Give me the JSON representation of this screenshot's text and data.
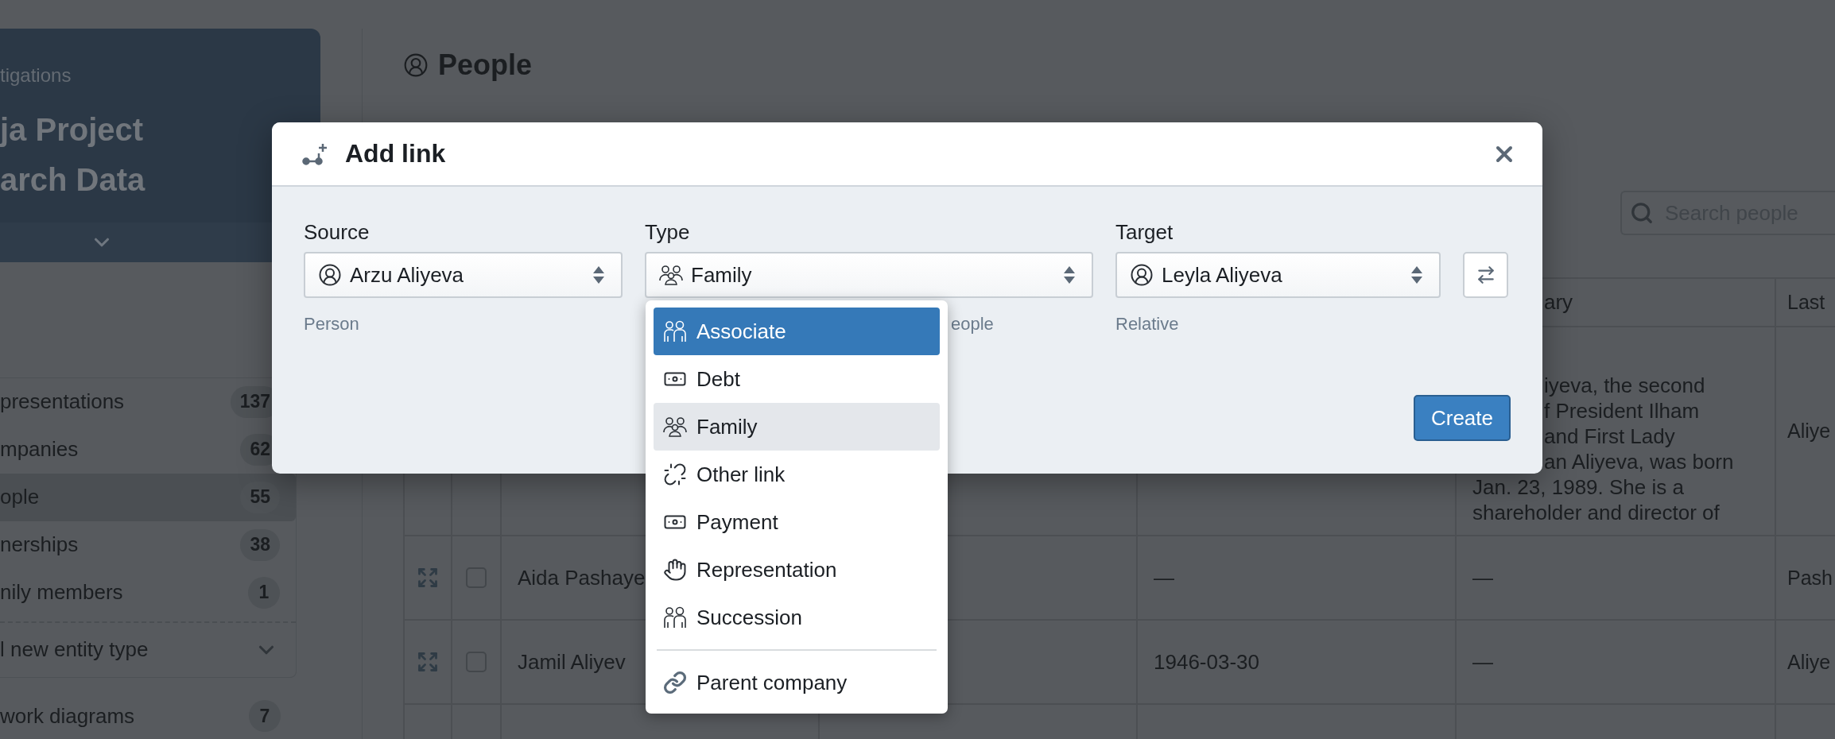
{
  "sidebar": {
    "header": {
      "subtitle": "tigations",
      "title_lines": [
        "ja Project",
        "arch Data"
      ]
    },
    "entity_types": [
      {
        "label": "presentations",
        "count": "137",
        "selected": false
      },
      {
        "label": "mpanies",
        "count": "62",
        "selected": false
      },
      {
        "label": "ople",
        "count": "55",
        "selected": true
      },
      {
        "label": "nerships",
        "count": "38",
        "selected": false
      },
      {
        "label": "nily members",
        "count": "1",
        "selected": false
      }
    ],
    "add_entity_type": "l new entity type",
    "diagrams": {
      "label": "work diagrams",
      "count": "7"
    }
  },
  "page": {
    "title": "People",
    "search": {
      "placeholder": "Search people"
    }
  },
  "table": {
    "header": {
      "column_6": "ary",
      "column_7": "Last"
    },
    "rows": [
      {
        "column_6_beside_dialog": [
          "iyeva, the second",
          "f President Ilham",
          "and First Lady",
          "an Aliyeva, was born"
        ],
        "column_6": [
          "Jan. 23, 1989. She is a",
          "shareholder and director of"
        ],
        "column_7": "Aliye"
      },
      {
        "checked": false,
        "name": "Aida Pashaye",
        "column_5": "—",
        "column_6": [
          "—"
        ],
        "column_7": "Pash"
      },
      {
        "checked": false,
        "name": "Jamil Aliyev",
        "column_5": "1946-03-30",
        "column_6": [
          "—"
        ],
        "column_7": "Aliye"
      }
    ]
  },
  "dialog": {
    "title": "Add link",
    "fields": [
      {
        "kind": "entity",
        "label": "Source",
        "value": "Arzu Aliyeva",
        "help": "Person"
      },
      {
        "kind": "type",
        "label": "Type",
        "value": "Family",
        "help": "eople",
        "open": true
      },
      {
        "kind": "entity",
        "label": "Target",
        "value": "Leyla Aliyeva",
        "help": "Relative"
      }
    ],
    "type_options": [
      [
        {
          "label": "Associate",
          "kind": "pair",
          "highlighted": true,
          "selected": false
        },
        {
          "label": "Debt",
          "kind": "money",
          "highlighted": false,
          "selected": false
        },
        {
          "label": "Family",
          "kind": "group",
          "highlighted": false,
          "selected": true
        },
        {
          "label": "Other link",
          "kind": "unknown",
          "highlighted": false,
          "selected": false
        },
        {
          "label": "Payment",
          "kind": "money",
          "highlighted": false,
          "selected": false
        },
        {
          "label": "Representation",
          "kind": "hand",
          "highlighted": false,
          "selected": false
        },
        {
          "label": "Succession",
          "kind": "pair",
          "highlighted": false,
          "selected": false
        }
      ],
      [
        {
          "label": "Parent company",
          "kind": "chain",
          "highlighted": false,
          "selected": false
        }
      ]
    ],
    "create_button": "Create"
  }
}
